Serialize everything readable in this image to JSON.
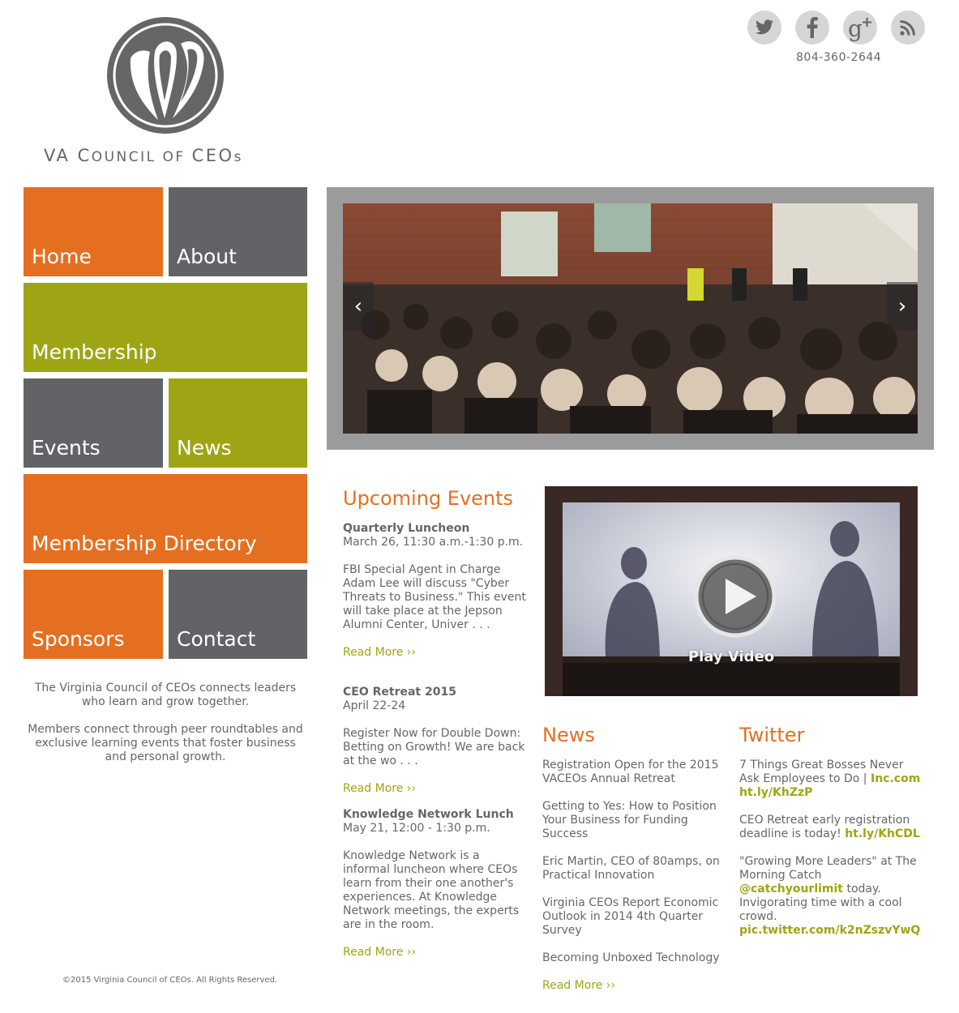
{
  "header": {
    "logo_text_1": "VA C",
    "logo_text_2": "OUNCIL OF ",
    "logo_text_3": "CEO",
    "logo_text_4": "s",
    "phone": "804-360-2644",
    "social": [
      "twitter-icon",
      "facebook-icon",
      "google-plus-icon",
      "rss-icon"
    ]
  },
  "nav": {
    "home": "Home",
    "about": "About",
    "membership": "Membership",
    "events": "Events",
    "news": "News",
    "directory": "Membership Directory",
    "sponsors": "Sponsors",
    "contact": "Contact"
  },
  "intro": {
    "p1": "The Virginia Council of CEOs connects leaders who learn and grow together.",
    "p2": "Members connect through peer roundtables and exclusive learning events that foster business and personal growth."
  },
  "slider": {
    "prev": "‹",
    "next": "›"
  },
  "events": {
    "heading": "Upcoming Events",
    "items": [
      {
        "title": "Quarterly Luncheon",
        "date": "March 26, 11:30 a.m.-1:30 p.m.",
        "desc": "FBI Special Agent in Charge Adam Lee will discuss \"Cyber Threats to Business.\"  This event will take place at the Jepson Alumni Center, Univer . . .",
        "more": "Read More ››"
      },
      {
        "title": "CEO Retreat 2015",
        "date": "April 22-24",
        "desc": "Register Now for Double Down: Betting on Growth!  We are back at the wo . . .",
        "more": "Read More ››"
      },
      {
        "title": "Knowledge Network Lunch",
        "date": "May 21, 12:00 - 1:30 p.m.",
        "desc": "Knowledge Network is a informal luncheon where CEOs learn from their one another's experiences.  At Knowledge Network meetings, the experts are in the room.",
        "more": "Read More ››"
      }
    ]
  },
  "video": {
    "label": "Play Video"
  },
  "news": {
    "heading": "News",
    "items": [
      "Registration Open for the 2015 VACEOs Annual Retreat",
      "Getting to Yes: How to Position Your Business for Funding Success",
      "Eric Martin, CEO of 80amps, on Practical Innovation",
      "Virginia CEOs Report Economic Outlook in 2014 4th Quarter Survey",
      "Becoming Unboxed Technology"
    ],
    "more": "Read More ››"
  },
  "twitter": {
    "heading": "Twitter",
    "t1_text": "7 Things Great Bosses Never Ask Employees to Do | ",
    "t1_link1": "Inc.com",
    "t1_link2": "ht.ly/KhZzP",
    "t2_text": "CEO Retreat early registration deadline is today! ",
    "t2_link": "ht.ly/KhCDL",
    "t3_text": "\"Growing More Leaders\" at The Morning Catch ",
    "t3_link1": "@catchyourlimit",
    "t3_text2": " today. Invigorating time with a cool crowd.",
    "t3_link2": "pic.twitter.com/k2nZszvYwQ"
  },
  "footer": {
    "copyright": "©2015 Virginia Council of CEOs. All Rights Reserved."
  },
  "colors": {
    "orange": "#e56f20",
    "gray": "#626366",
    "green": "#9ea514",
    "frame": "#9b9b9b"
  }
}
